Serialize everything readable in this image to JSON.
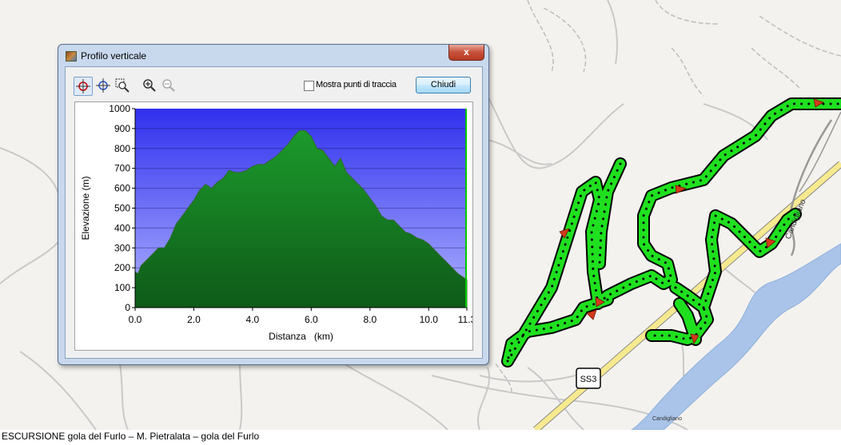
{
  "window": {
    "title": "Profilo verticale",
    "close_glyph": "x",
    "show_points_label": "Mostra punti di traccia",
    "close_button_label": "Chiudi",
    "toolbar_icons": [
      "crosshair-select-icon",
      "pan-crosshair-icon",
      "zoom-rect-icon",
      "zoom-in-icon",
      "zoom-out-icon"
    ]
  },
  "map": {
    "road_label": "SS3",
    "place_label_1": "Candigliano",
    "place_label_2": "Candigliano",
    "track_color": "#1fe01f",
    "river_color": "#a9c4e8"
  },
  "caption": "ESCURSIONE gola del Furlo – M. Pietralata – gola del Furlo",
  "chart_data": {
    "type": "area",
    "xlabel": "Distanza   (km)",
    "ylabel": "Elevazione (m)",
    "xlim": [
      0.0,
      11.3
    ],
    "ylim": [
      0,
      1000
    ],
    "x_ticks": [
      "0.0",
      "2.0",
      "4.0",
      "6.0",
      "8.0",
      "10.0",
      "11.3"
    ],
    "x_tick_values": [
      0,
      2,
      4,
      6,
      8,
      10,
      11.3
    ],
    "y_ticks": [
      "0",
      "100",
      "200",
      "300",
      "400",
      "500",
      "600",
      "700",
      "800",
      "900",
      "1000"
    ],
    "y_tick_values": [
      0,
      100,
      200,
      300,
      400,
      500,
      600,
      700,
      800,
      900,
      1000
    ],
    "x": [
      0.0,
      0.1,
      0.2,
      0.4,
      0.6,
      0.8,
      1.0,
      1.2,
      1.4,
      1.6,
      1.8,
      2.0,
      2.2,
      2.4,
      2.6,
      2.8,
      3.0,
      3.2,
      3.4,
      3.6,
      3.8,
      4.0,
      4.2,
      4.4,
      4.6,
      4.8,
      5.0,
      5.2,
      5.4,
      5.6,
      5.8,
      6.0,
      6.2,
      6.4,
      6.6,
      6.8,
      7.0,
      7.2,
      7.4,
      7.6,
      7.8,
      8.0,
      8.2,
      8.4,
      8.6,
      8.8,
      9.0,
      9.2,
      9.4,
      9.6,
      9.8,
      10.0,
      10.2,
      10.4,
      10.6,
      10.8,
      11.0,
      11.2,
      11.3
    ],
    "values": [
      180,
      170,
      210,
      240,
      270,
      300,
      300,
      350,
      420,
      460,
      500,
      540,
      590,
      620,
      600,
      630,
      650,
      690,
      680,
      680,
      690,
      710,
      720,
      720,
      740,
      760,
      790,
      820,
      860,
      890,
      890,
      860,
      800,
      790,
      750,
      710,
      750,
      680,
      650,
      620,
      590,
      550,
      510,
      460,
      440,
      440,
      410,
      380,
      370,
      350,
      340,
      320,
      290,
      260,
      230,
      200,
      170,
      150,
      140
    ],
    "grid": true,
    "colors": {
      "fill_top": "#1a8f2a",
      "fill_bottom": "#0f5c1a",
      "sky_top": "#3333ee",
      "sky_bottom": "#aab0ff",
      "line": "#5a8f5a",
      "right_marker": "#00cc00"
    }
  }
}
